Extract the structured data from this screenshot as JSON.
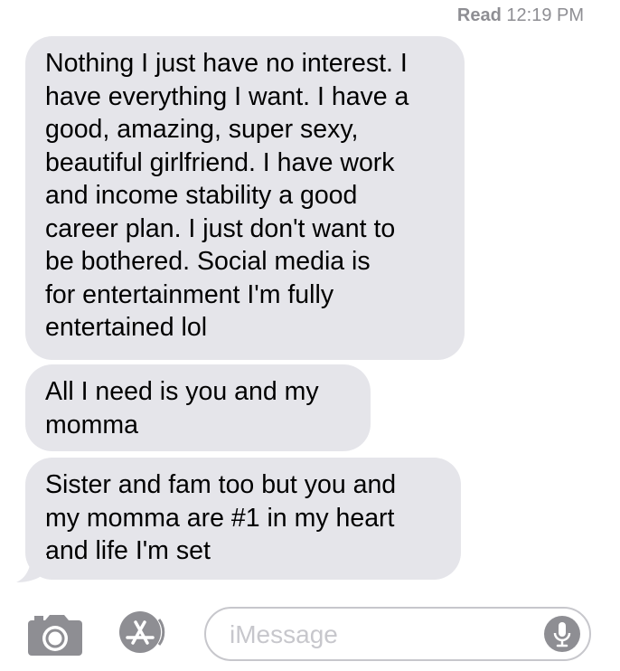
{
  "thread": {
    "read_status_label": "Read",
    "read_time": "12:19 PM"
  },
  "messages": [
    {
      "direction": "incoming",
      "text": "Nothing I just have no interest. I\nhave everything I want. I have a\ngood, amazing, super sexy,\nbeautiful girlfriend. I have work\nand income stability a good\ncareer plan. I just don't want to\nbe bothered. Social media is\nfor entertainment I'm fully\nentertained lol"
    },
    {
      "direction": "incoming",
      "text": "All I need is you and my\nmomma"
    },
    {
      "direction": "incoming",
      "text": "Sister and fam too but you and\nmy momma are #1 in my heart\nand life I'm set"
    }
  ],
  "composer": {
    "placeholder": "iMessage",
    "camera_icon": "camera-icon",
    "apps_icon": "app-store-icon",
    "mic_icon": "microphone-icon"
  },
  "colors": {
    "bubble_incoming": "#e5e5ea",
    "secondary_text": "#8e8e93",
    "field_border": "#c7c7cc"
  }
}
